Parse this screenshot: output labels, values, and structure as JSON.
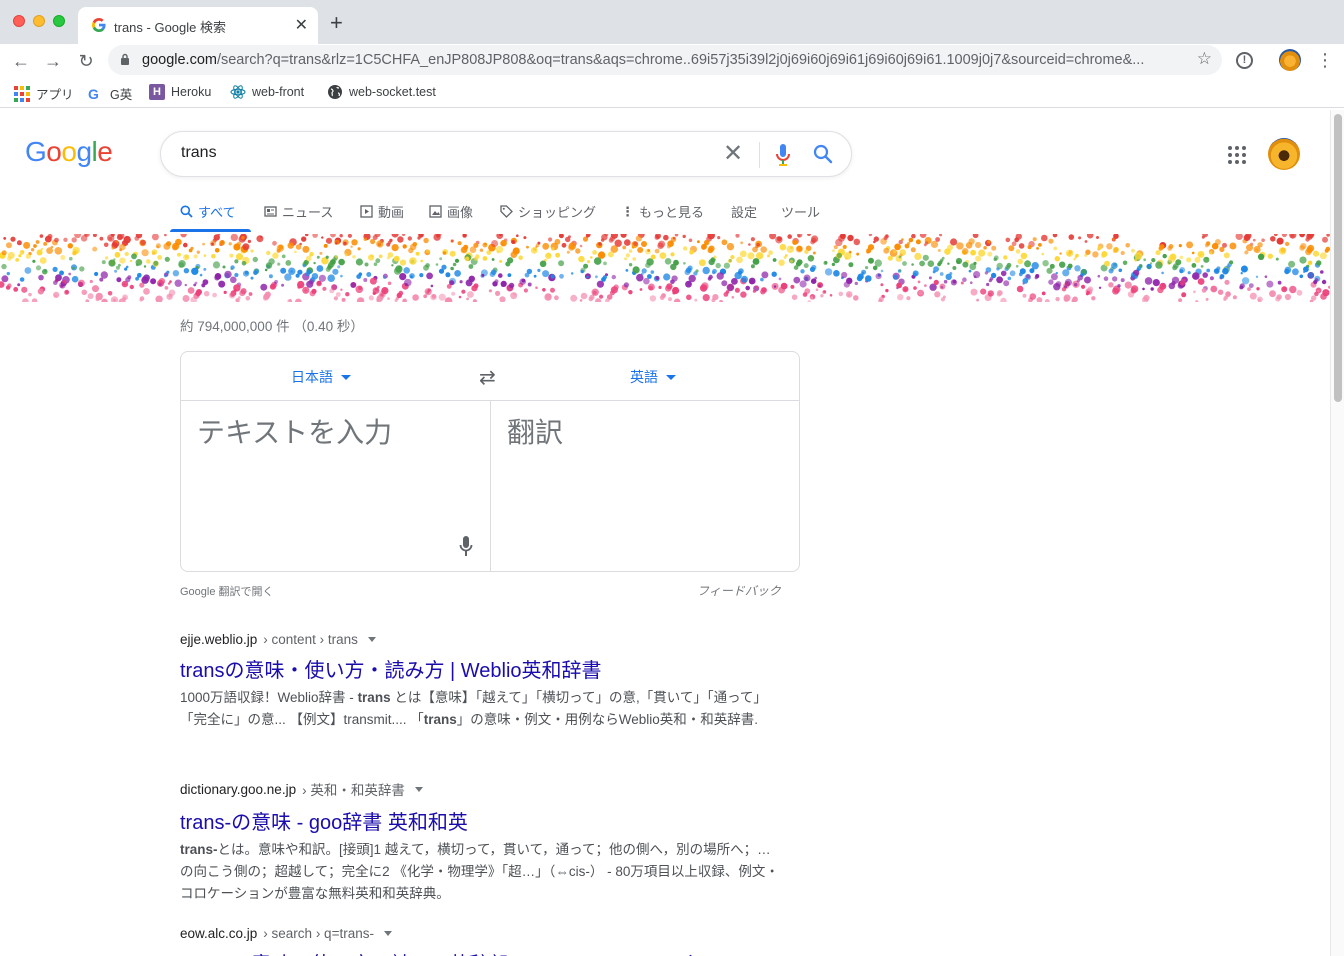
{
  "browser": {
    "tab_title": "trans - Google 検索",
    "new_tab": "+",
    "url_host": "google.com",
    "url_path": "/search?q=trans&rlz=1C5CHFA_enJP808JP808&oq=trans&aqs=chrome..69i57j35i39l2j0j69i60j69i61j69i60j69i61.1009j0j7&sourceid=chrome&..."
  },
  "bookmarks": [
    {
      "label": "アプリ",
      "icon": "apps-grid-icon"
    },
    {
      "label": "G英",
      "icon": "google-g-icon"
    },
    {
      "label": "Heroku",
      "icon": "heroku-icon"
    },
    {
      "label": "web-front",
      "icon": "react-icon"
    },
    {
      "label": "web-socket.test",
      "icon": "globe-icon"
    }
  ],
  "search": {
    "query": "trans",
    "logo_letters": [
      "G",
      "o",
      "o",
      "g",
      "l",
      "e"
    ]
  },
  "nav_tabs": [
    {
      "label": "すべて",
      "icon": "search-icon",
      "active": true
    },
    {
      "label": "ニュース",
      "icon": "news-icon"
    },
    {
      "label": "動画",
      "icon": "video-icon"
    },
    {
      "label": "画像",
      "icon": "image-icon"
    },
    {
      "label": "ショッピング",
      "icon": "tag-icon"
    },
    {
      "label": "もっと見る",
      "icon": "more-vert-icon"
    },
    {
      "label": "設定"
    },
    {
      "label": "ツール"
    }
  ],
  "result_stats": "約 794,000,000 件 （0.40 秒）",
  "translate": {
    "source_lang": "日本語",
    "target_lang": "英語",
    "source_placeholder": "テキストを入力",
    "target_placeholder": "翻訳",
    "open_link": "Google 翻訳で開く",
    "feedback": "フィードバック"
  },
  "results": [
    {
      "domain": "ejje.weblio.jp",
      "crumbs": " › content › trans",
      "title": "transの意味・使い方・読み方 | Weblio英和辞書",
      "snippet": [
        {
          "t": "1000万語収録！Weblio辞書 - "
        },
        {
          "t": "trans",
          "b": true
        },
        {
          "t": " とは【意味】「越えて」「横切って」の意,「貫いて」「通って」「完全に」の意... 【例文】transmit.... 「"
        },
        {
          "t": "trans",
          "b": true
        },
        {
          "t": "」の意味・例文・用例ならWeblio英和・和英辞書."
        }
      ]
    },
    {
      "domain": "dictionary.goo.ne.jp",
      "crumbs": " › 英和・和英辞書",
      "title": "trans-の意味 - goo辞書 英和和英",
      "snippet": [
        {
          "t": "trans-",
          "b": true
        },
        {
          "t": "とは。意味や和訳。[接頭]1 越えて，横切って，貫いて，通って；他の側へ，別の場所へ；…の向こう側の；超越して；完全に2 《化学・物理学》「超…」（⇔cis-） - 80万項目以上収録、例文・コロケーションが豊富な無料英和和英辞典。"
        }
      ]
    },
    {
      "domain": "eow.alc.co.jp",
      "crumbs": " › search › q=trans-",
      "title": "trans-の意味・使い方・読み - 英辞郎 on the WEB：アルク",
      "snippet": []
    }
  ],
  "colors": {
    "link": "#1a0dab",
    "accent": "#1a73e8",
    "google_blue": "#4285f4",
    "google_red": "#ea4335",
    "google_yellow": "#fbbc05",
    "google_green": "#34a853"
  }
}
